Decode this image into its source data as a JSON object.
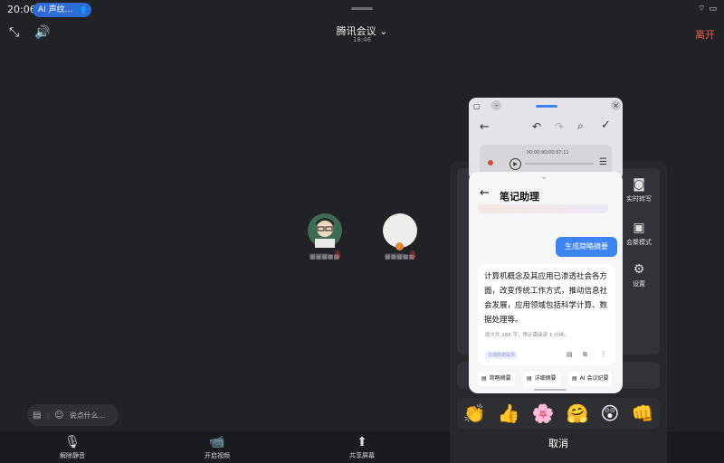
{
  "status": {
    "time": "20:06",
    "ai_pill": "AI 声纹...",
    "battery": "▮"
  },
  "header": {
    "title": "腾讯会议",
    "duration": "18:46",
    "leave": "离开"
  },
  "participants": [
    {
      "name": "■■■■■"
    },
    {
      "name": "■■■■■"
    }
  ],
  "chat": {
    "placeholder": "说点什么..."
  },
  "bottom": {
    "unmute": "解除静音",
    "video": "开启视频",
    "share": "共享屏幕"
  },
  "side_menu": {
    "transcribe": "实时转写",
    "gallery": "会聚模式",
    "settings": "设置"
  },
  "notes": {
    "player_time": "00:00:00/00:07:11",
    "title": "笔记助理",
    "summary_button": "生成简略摘要",
    "summary_text": "计算机概念及其应用已渗透社会各方面，改变传统工作方式，推动信息社会发展，应用领域包括科学计算、数据处理等。",
    "meta": "原文共 286 字，预计需阅读 1 分钟。",
    "tag": "云端数据提供",
    "chips": [
      "简略摘要",
      "详细摘要",
      "AI 会议纪要"
    ]
  },
  "reactions": [
    "👏",
    "👍",
    "🌸",
    "🤗",
    "😲",
    "👊"
  ],
  "cancel": "取消"
}
